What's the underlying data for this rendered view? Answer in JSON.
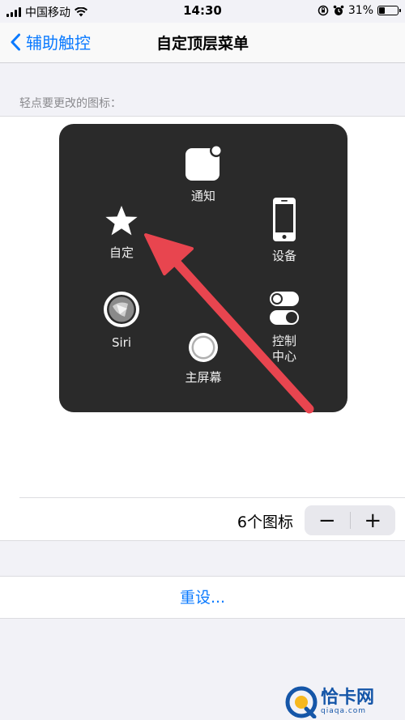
{
  "status_bar": {
    "carrier": "中国移动",
    "time": "14:30",
    "battery_percent": "31%",
    "battery_level": 0.31
  },
  "nav": {
    "back_label": "辅助触控",
    "title": "自定顶层菜单"
  },
  "section": {
    "header": "轻点要更改的图标："
  },
  "menu": {
    "items": [
      {
        "label": "通知",
        "icon": "notification-icon"
      },
      {
        "label": "自定",
        "icon": "star-icon"
      },
      {
        "label": "设备",
        "icon": "device-icon"
      },
      {
        "label": "Siri",
        "icon": "siri-icon"
      },
      {
        "label": "主屏幕",
        "icon": "home-button-icon"
      },
      {
        "label": "控制中心",
        "icon": "control-center-icon"
      }
    ]
  },
  "stepper": {
    "count_label": "6个图标",
    "minus": "−",
    "plus": "+"
  },
  "reset": {
    "label": "重设..."
  },
  "watermark": {
    "title": "恰卡网",
    "subtitle": "qiaqa.com"
  },
  "colors": {
    "accent": "#0a7aff",
    "menu_background": "#2a2a2a",
    "annotation_arrow": "#e8454f"
  }
}
